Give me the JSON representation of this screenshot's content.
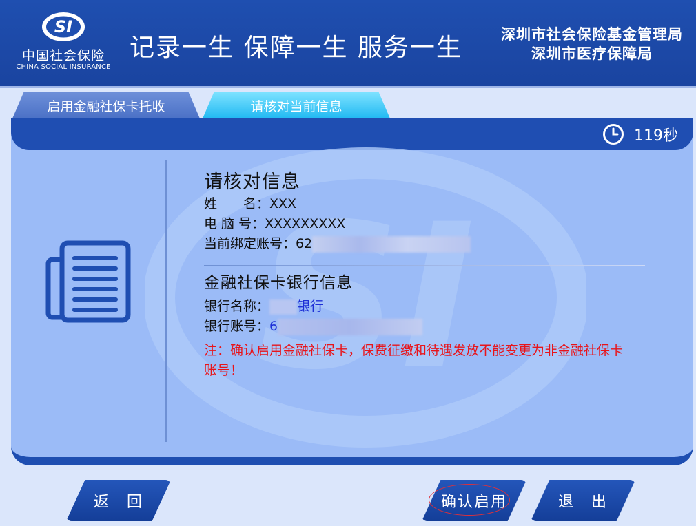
{
  "header": {
    "logo_mark": "SI",
    "logo_cn": "中国社会保险",
    "logo_en": "CHINA SOCIAL INSURANCE",
    "slogan": "记录一生  保障一生  服务一生",
    "org_line1": "深圳市社会保险基金管理局",
    "org_line2": "深圳市医疗保障局"
  },
  "tabs": [
    {
      "label": "启用金融社保卡托收",
      "active": false
    },
    {
      "label": "请核对当前信息",
      "active": true
    }
  ],
  "timer": {
    "text": "119秒",
    "icon": "clock-icon"
  },
  "watermark": "SI",
  "info": {
    "title": "请核对信息",
    "name_label": "姓　　名：",
    "name_value": "XXX",
    "pc_label": "电 脑 号：",
    "pc_value": "XXXXXXXXX",
    "account_label": "当前绑定账号：",
    "account_value": "62",
    "bank_section_title": "金融社保卡银行信息",
    "bank_name_label": "银行名称：",
    "bank_name_value": "银行",
    "bank_account_label": "银行账号：",
    "bank_account_value": "6",
    "note": "注：确认启用金融社保卡，保费征缴和待遇发放不能变更为非金融社保卡账号！"
  },
  "buttons": {
    "back": "返　回",
    "confirm": "确认启用",
    "exit": "退　出"
  },
  "colors": {
    "header_bg": "#1f4fb0",
    "panel_bg": "#9bbbf7",
    "active_tab": "#21b9f2",
    "note_red": "#e8141a",
    "value_blue": "#1d2fd6"
  }
}
